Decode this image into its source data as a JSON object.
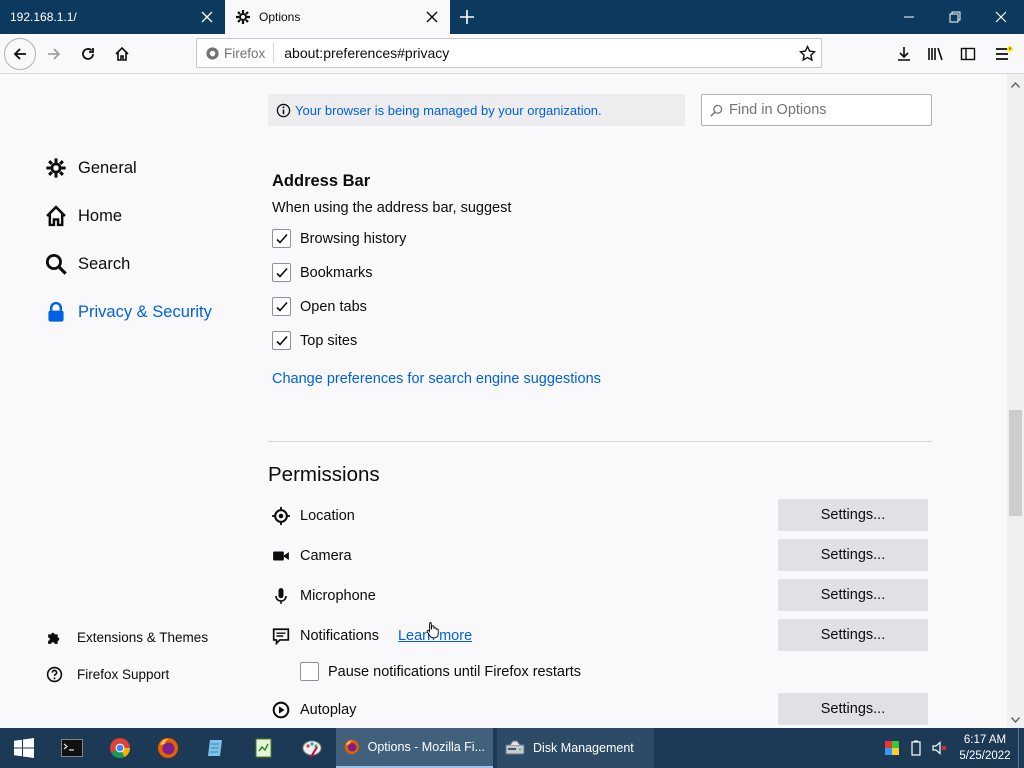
{
  "tabs": [
    {
      "title": "192.168.1.1/",
      "active": false
    },
    {
      "title": "Options",
      "active": true
    }
  ],
  "navbar": {
    "identity_label": "Firefox",
    "url": "about:preferences#privacy"
  },
  "sidebar": {
    "categories": [
      {
        "label": "General",
        "icon": "gear-icon"
      },
      {
        "label": "Home",
        "icon": "home-icon"
      },
      {
        "label": "Search",
        "icon": "search-icon"
      },
      {
        "label": "Privacy & Security",
        "icon": "lock-icon",
        "selected": true
      }
    ],
    "footer": [
      {
        "label": "Extensions & Themes",
        "icon": "puzzle-icon"
      },
      {
        "label": "Firefox Support",
        "icon": "help-icon"
      }
    ]
  },
  "managed_notice": "Your browser is being managed by your organization.",
  "find": {
    "placeholder": "Find in Options"
  },
  "address_bar": {
    "heading": "Address Bar",
    "description": "When using the address bar, suggest",
    "options": [
      {
        "label": "Browsing history",
        "checked": true
      },
      {
        "label": "Bookmarks",
        "checked": true
      },
      {
        "label": "Open tabs",
        "checked": true
      },
      {
        "label": "Top sites",
        "checked": true
      }
    ],
    "link": "Change preferences for search engine suggestions"
  },
  "permissions": {
    "heading": "Permissions",
    "items": [
      {
        "label": "Location",
        "icon": "location-icon",
        "button": "Settings..."
      },
      {
        "label": "Camera",
        "icon": "camera-icon",
        "button": "Settings..."
      },
      {
        "label": "Microphone",
        "icon": "microphone-icon",
        "button": "Settings..."
      },
      {
        "label": "Notifications",
        "icon": "notification-icon",
        "button": "Settings...",
        "link": "Learn more"
      },
      {
        "label": "Autoplay",
        "icon": "autoplay-icon",
        "button": "Settings..."
      }
    ],
    "pause_notifications": {
      "label": "Pause notifications until Firefox restarts",
      "checked": false
    }
  },
  "taskbar": {
    "apps": [
      {
        "label": "Options - Mozilla Fi...",
        "active": true
      },
      {
        "label": "Disk Management",
        "active": false
      }
    ],
    "clock": {
      "time": "6:17 AM",
      "date": "5/25/2022"
    }
  },
  "colors": {
    "accent": "#0060df",
    "titlebar": "#0c3a5e",
    "taskbar": "#1c3a56"
  }
}
